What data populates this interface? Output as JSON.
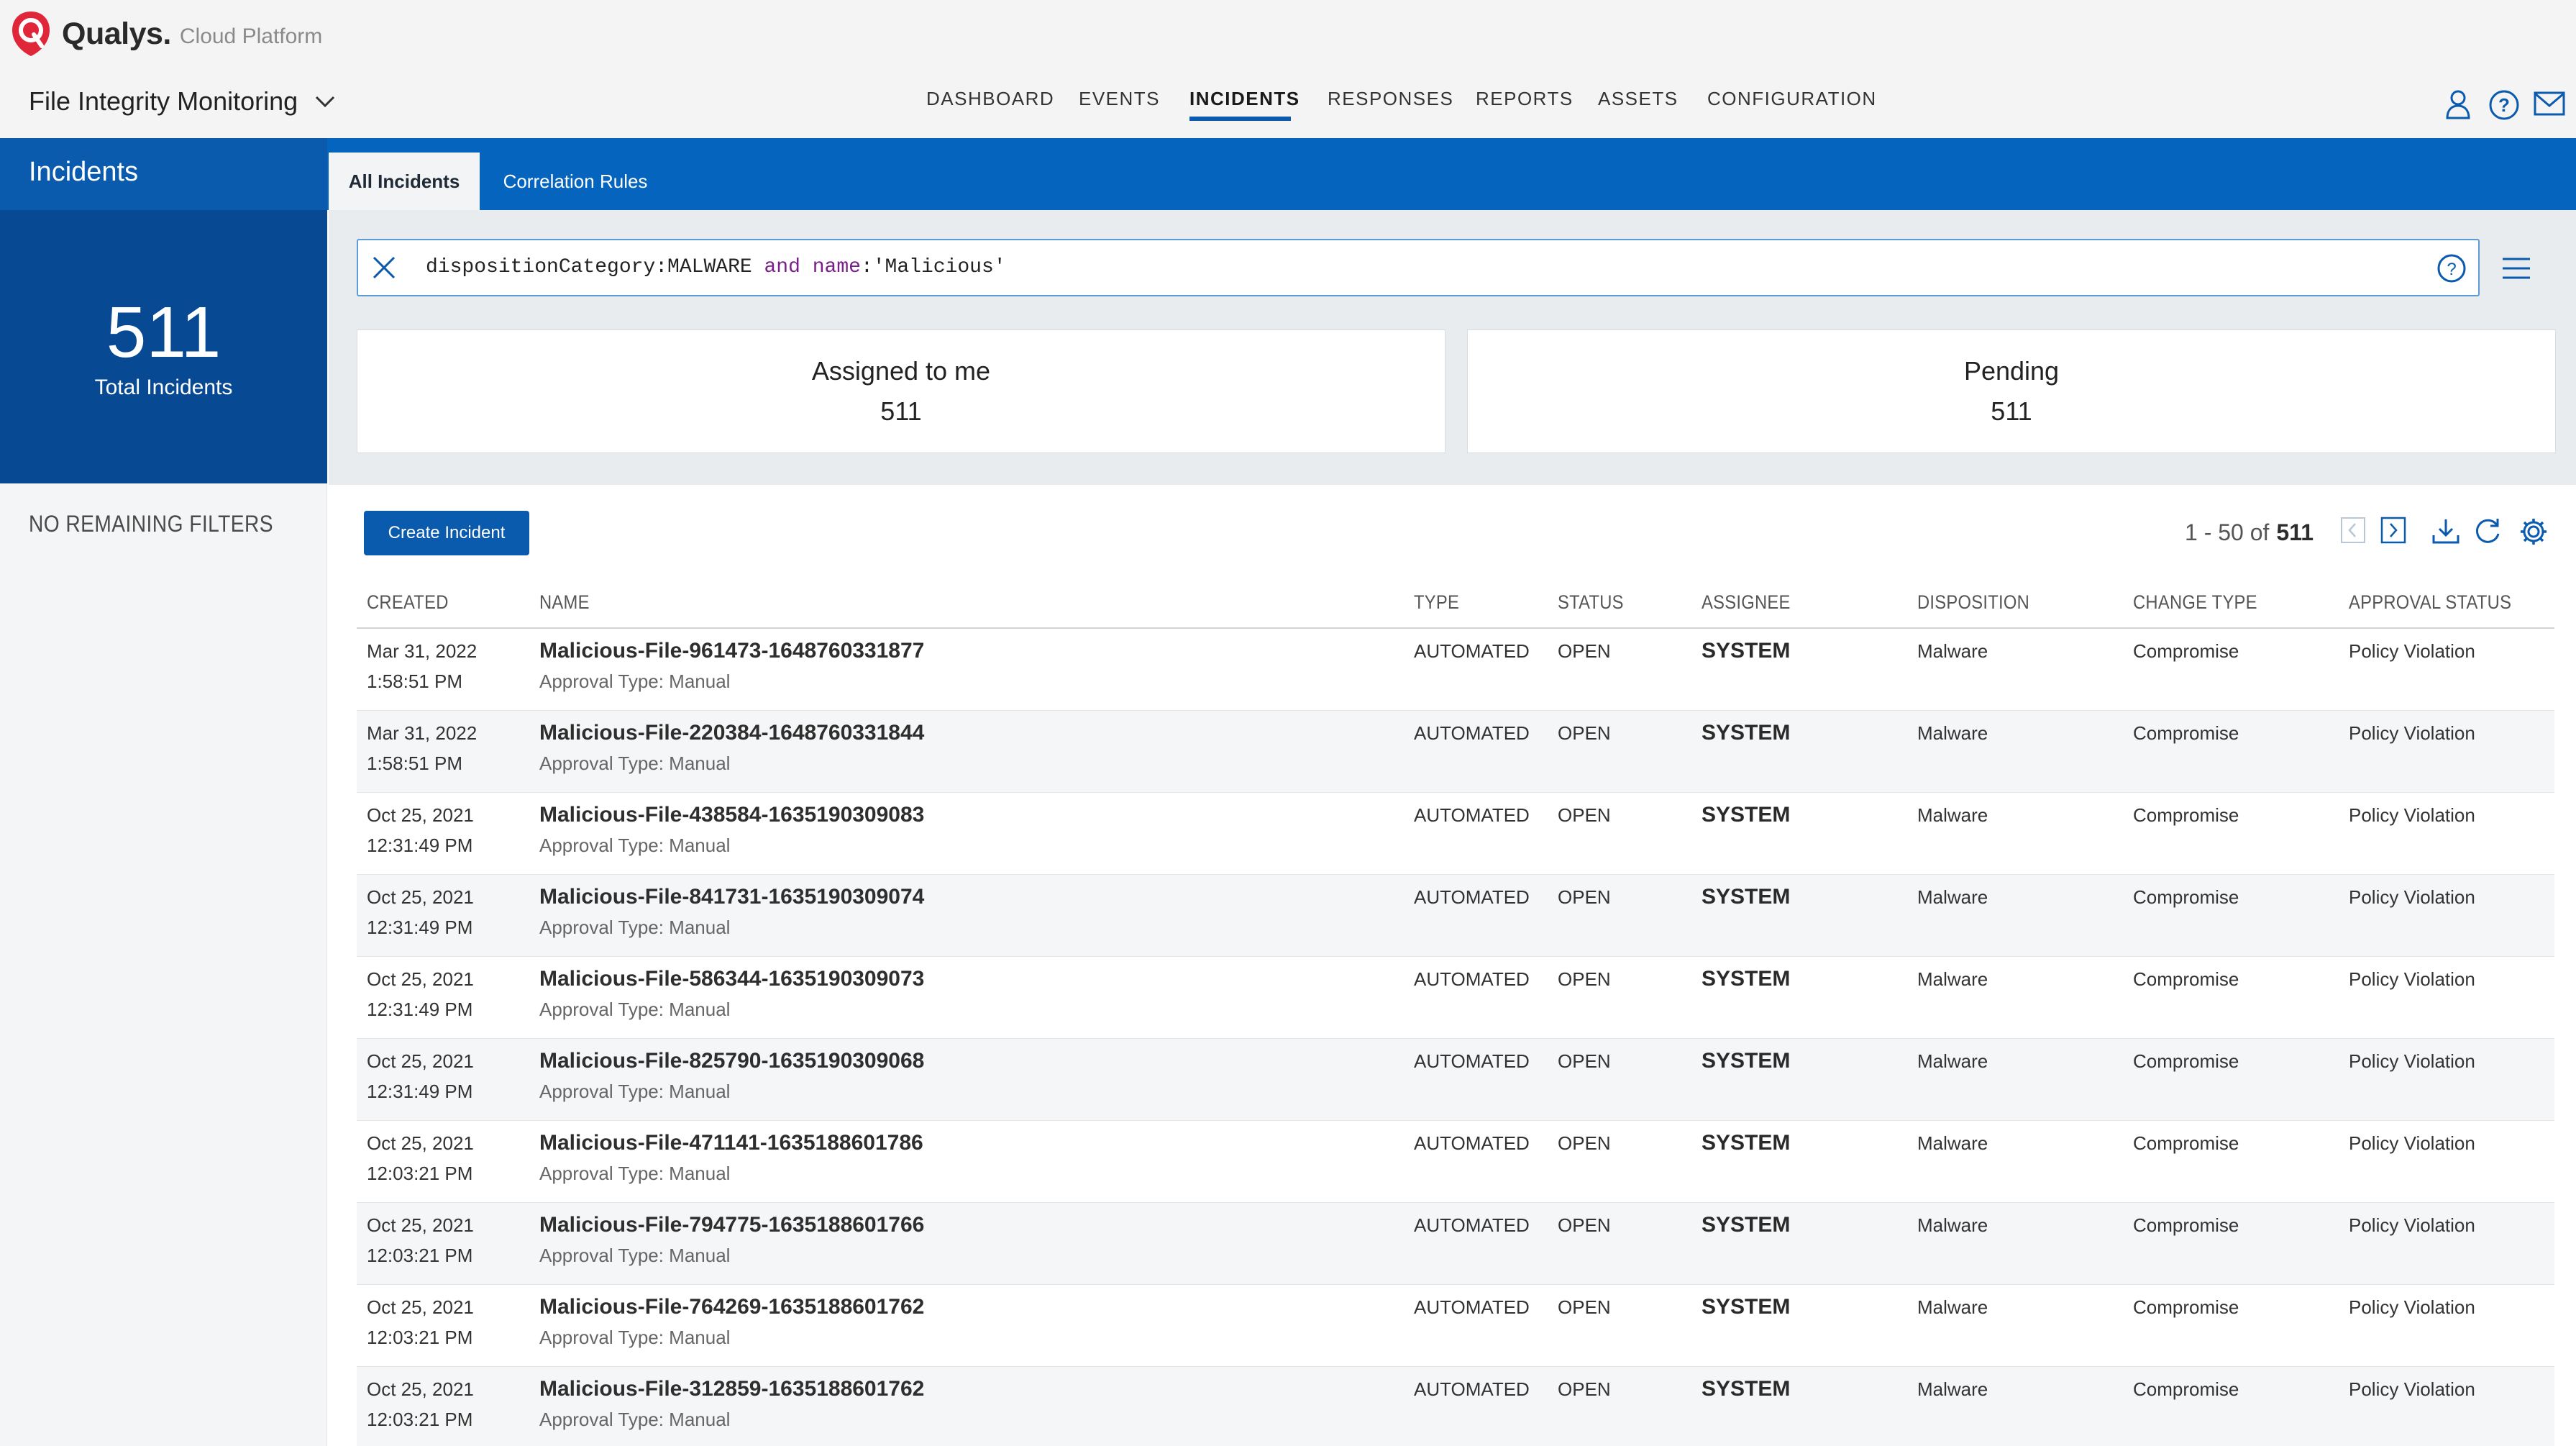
{
  "app": {
    "brand": "Qualys.",
    "brand_sub": "Cloud Platform",
    "module": "File Integrity Monitoring",
    "accent_color": "#0565be",
    "logo_color": "#e0273a"
  },
  "nav": [
    {
      "label": "DASHBOARD",
      "active": false
    },
    {
      "label": "EVENTS",
      "active": false
    },
    {
      "label": "INCIDENTS",
      "active": true
    },
    {
      "label": "RESPONSES",
      "active": false
    },
    {
      "label": "REPORTS",
      "active": false
    },
    {
      "label": "ASSETS",
      "active": false
    },
    {
      "label": "CONFIGURATION",
      "active": false
    }
  ],
  "header_icons": [
    "user-icon",
    "help-icon",
    "mail-icon"
  ],
  "section_title": "Incidents",
  "tabs": [
    {
      "label": "All Incidents",
      "active": true
    },
    {
      "label": "Correlation Rules",
      "active": false
    }
  ],
  "sidebar": {
    "total": "511",
    "total_label": "Total Incidents",
    "filters_label": "NO REMAINING FILTERS"
  },
  "search": {
    "query_parts": [
      "dispositionCategory:MALWARE ",
      "and",
      " ",
      "name",
      ":'Malicious'"
    ]
  },
  "cards": [
    {
      "title": "Assigned to me",
      "value": "511"
    },
    {
      "title": "Pending",
      "value": "511"
    }
  ],
  "toolbar": {
    "create_label": "Create Incident",
    "paging_range": "1 - 50 of",
    "paging_total": "511"
  },
  "table": {
    "columns": [
      "CREATED",
      "NAME",
      "TYPE",
      "STATUS",
      "ASSIGNEE",
      "DISPOSITION",
      "CHANGE TYPE",
      "APPROVAL STATUS"
    ],
    "rows": [
      {
        "date": "Mar 31, 2022",
        "time": "1:58:51 PM",
        "name": "Malicious-File-961473-1648760331877",
        "sub": "Approval Type: Manual",
        "type": "AUTOMATED",
        "status": "OPEN",
        "assignee": "SYSTEM",
        "disposition": "Malware",
        "change": "Compromise",
        "approval": "Policy Violation"
      },
      {
        "date": "Mar 31, 2022",
        "time": "1:58:51 PM",
        "name": "Malicious-File-220384-1648760331844",
        "sub": "Approval Type: Manual",
        "type": "AUTOMATED",
        "status": "OPEN",
        "assignee": "SYSTEM",
        "disposition": "Malware",
        "change": "Compromise",
        "approval": "Policy Violation"
      },
      {
        "date": "Oct 25, 2021",
        "time": "12:31:49 PM",
        "name": "Malicious-File-438584-1635190309083",
        "sub": "Approval Type: Manual",
        "type": "AUTOMATED",
        "status": "OPEN",
        "assignee": "SYSTEM",
        "disposition": "Malware",
        "change": "Compromise",
        "approval": "Policy Violation"
      },
      {
        "date": "Oct 25, 2021",
        "time": "12:31:49 PM",
        "name": "Malicious-File-841731-1635190309074",
        "sub": "Approval Type: Manual",
        "type": "AUTOMATED",
        "status": "OPEN",
        "assignee": "SYSTEM",
        "disposition": "Malware",
        "change": "Compromise",
        "approval": "Policy Violation"
      },
      {
        "date": "Oct 25, 2021",
        "time": "12:31:49 PM",
        "name": "Malicious-File-586344-1635190309073",
        "sub": "Approval Type: Manual",
        "type": "AUTOMATED",
        "status": "OPEN",
        "assignee": "SYSTEM",
        "disposition": "Malware",
        "change": "Compromise",
        "approval": "Policy Violation"
      },
      {
        "date": "Oct 25, 2021",
        "time": "12:31:49 PM",
        "name": "Malicious-File-825790-1635190309068",
        "sub": "Approval Type: Manual",
        "type": "AUTOMATED",
        "status": "OPEN",
        "assignee": "SYSTEM",
        "disposition": "Malware",
        "change": "Compromise",
        "approval": "Policy Violation"
      },
      {
        "date": "Oct 25, 2021",
        "time": "12:03:21 PM",
        "name": "Malicious-File-471141-1635188601786",
        "sub": "Approval Type: Manual",
        "type": "AUTOMATED",
        "status": "OPEN",
        "assignee": "SYSTEM",
        "disposition": "Malware",
        "change": "Compromise",
        "approval": "Policy Violation"
      },
      {
        "date": "Oct 25, 2021",
        "time": "12:03:21 PM",
        "name": "Malicious-File-794775-1635188601766",
        "sub": "Approval Type: Manual",
        "type": "AUTOMATED",
        "status": "OPEN",
        "assignee": "SYSTEM",
        "disposition": "Malware",
        "change": "Compromise",
        "approval": "Policy Violation"
      },
      {
        "date": "Oct 25, 2021",
        "time": "12:03:21 PM",
        "name": "Malicious-File-764269-1635188601762",
        "sub": "Approval Type: Manual",
        "type": "AUTOMATED",
        "status": "OPEN",
        "assignee": "SYSTEM",
        "disposition": "Malware",
        "change": "Compromise",
        "approval": "Policy Violation"
      },
      {
        "date": "Oct 25, 2021",
        "time": "12:03:21 PM",
        "name": "Malicious-File-312859-1635188601762",
        "sub": "Approval Type: Manual",
        "type": "AUTOMATED",
        "status": "OPEN",
        "assignee": "SYSTEM",
        "disposition": "Malware",
        "change": "Compromise",
        "approval": "Policy Violation"
      }
    ]
  }
}
